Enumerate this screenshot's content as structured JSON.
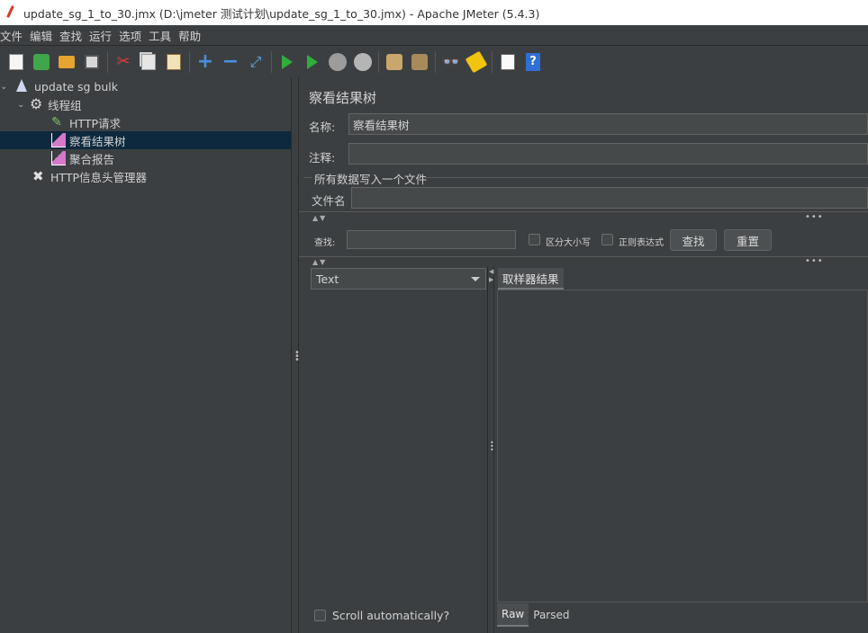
{
  "window": {
    "title": "update_sg_1_to_30.jmx (D:\\jmeter 测试计划\\update_sg_1_to_30.jmx) - Apache JMeter (5.4.3)"
  },
  "menu": [
    "文件",
    "编辑",
    "查找",
    "运行",
    "选项",
    "工具",
    "帮助"
  ],
  "toolbar": [
    "new-icon",
    "templates-icon",
    "open-icon",
    "save-icon",
    "cut-icon",
    "copy-icon",
    "paste-icon",
    "expand-icon",
    "collapse-icon",
    "toggle-icon",
    "start-icon",
    "start-no-pauses-icon",
    "stop-icon",
    "shutdown-icon",
    "clear-icon",
    "clear-all-icon",
    "search-icon",
    "reset-search-icon",
    "function-helper-icon",
    "help-icon"
  ],
  "tree": {
    "root": "update sg bulk",
    "thread_group": "线程组",
    "http_request": "HTTP请求",
    "result_tree": "察看结果树",
    "aggregate": "聚合报告",
    "header_manager": "HTTP信息头管理器"
  },
  "panel": {
    "title": "察看结果树",
    "name_label": "名称:",
    "name_value": "察看结果树",
    "comment_label": "注释:",
    "comment_value": "",
    "fileset_title": "所有数据写入一个文件",
    "filename_label": "文件名",
    "filename_value": "",
    "search_label": "查找:",
    "search_value": "",
    "case_label": "区分大小写",
    "regex_label": "正则表达式",
    "find_button": "查找",
    "reset_button": "重置",
    "renderer_selected": "Text",
    "tab_sampler_result": "取样器结果",
    "tab_raw": "Raw",
    "tab_parsed": "Parsed",
    "scroll_label": "Scroll automatically?"
  }
}
